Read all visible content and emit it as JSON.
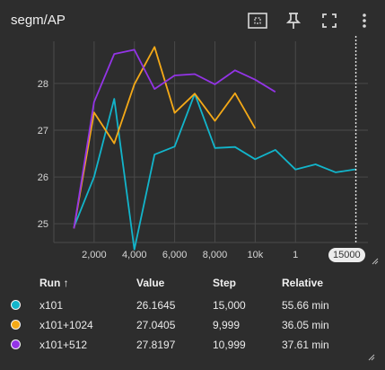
{
  "card": {
    "title": "segm/AP"
  },
  "toolbar": {
    "icons": [
      "fit-domain-icon",
      "pin-icon",
      "fullscreen-icon",
      "more-vert-icon"
    ]
  },
  "chart_data": {
    "type": "line",
    "xlabel": "",
    "ylabel": "",
    "x_ticks": [
      "2,000",
      "4,000",
      "6,000",
      "8,000",
      "10k",
      "1"
    ],
    "y_ticks": [
      "25",
      "26",
      "27",
      "28"
    ],
    "ylim": [
      24.6,
      28.9
    ],
    "xlim": [
      0,
      15600
    ],
    "grid": true,
    "cursor_step": "15000",
    "series": [
      {
        "name": "x101",
        "color": "#12b5cb",
        "points": [
          [
            999,
            24.93
          ],
          [
            1999,
            26.0
          ],
          [
            2999,
            27.67
          ],
          [
            3999,
            24.45
          ],
          [
            4999,
            26.48
          ],
          [
            5999,
            26.65
          ],
          [
            6999,
            27.78
          ],
          [
            7999,
            26.62
          ],
          [
            8999,
            26.64
          ],
          [
            9999,
            26.38
          ],
          [
            10999,
            26.58
          ],
          [
            11999,
            26.16
          ],
          [
            12999,
            26.27
          ],
          [
            13999,
            26.1
          ],
          [
            15000,
            26.1645
          ]
        ]
      },
      {
        "name": "x101+1024",
        "color": "#f4a917",
        "points": [
          [
            999,
            24.9
          ],
          [
            1999,
            27.38
          ],
          [
            2999,
            26.72
          ],
          [
            3999,
            27.98
          ],
          [
            4999,
            28.78
          ],
          [
            5999,
            27.37
          ],
          [
            6999,
            27.78
          ],
          [
            7999,
            27.2
          ],
          [
            8999,
            27.79
          ],
          [
            9999,
            27.0405
          ]
        ]
      },
      {
        "name": "x101+512",
        "color": "#9334e6",
        "points": [
          [
            999,
            24.9
          ],
          [
            1999,
            27.6
          ],
          [
            2999,
            28.63
          ],
          [
            3999,
            28.72
          ],
          [
            4999,
            27.88
          ],
          [
            5999,
            28.17
          ],
          [
            6999,
            28.2
          ],
          [
            7999,
            27.98
          ],
          [
            8999,
            28.28
          ],
          [
            9999,
            28.08
          ],
          [
            10999,
            27.8197
          ]
        ]
      }
    ]
  },
  "table": {
    "headers": {
      "run": "Run ↑",
      "value": "Value",
      "step": "Step",
      "relative": "Relative"
    },
    "rows": [
      {
        "run": "x101",
        "value": "26.1645",
        "step": "15,000",
        "relative": "55.66 min",
        "color": "#12b5cb"
      },
      {
        "run": "x101+1024",
        "value": "27.0405",
        "step": "9,999",
        "relative": "36.05 min",
        "color": "#f4a917"
      },
      {
        "run": "x101+512",
        "value": "27.8197",
        "step": "10,999",
        "relative": "37.61 min",
        "color": "#9334e6"
      }
    ]
  }
}
